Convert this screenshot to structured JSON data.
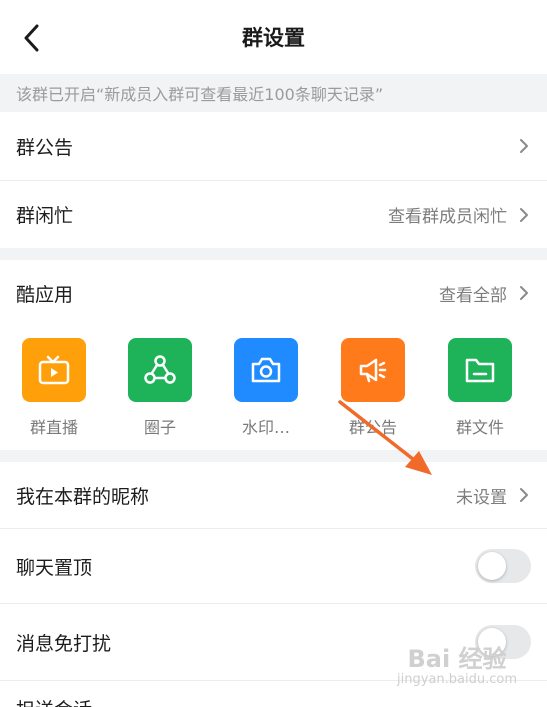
{
  "header": {
    "title": "群设置"
  },
  "notice": "该群已开启“新成员入群可查看最近100条聊天记录”",
  "rows": {
    "announcement": {
      "label": "群公告"
    },
    "busy": {
      "label": "群闲忙",
      "value": "查看群成员闲忙"
    },
    "cool_apps": {
      "label": "酷应用",
      "value": "查看全部"
    },
    "nickname": {
      "label": "我在本群的昵称",
      "value": "未设置"
    },
    "pin_chat": {
      "label": "聊天置顶",
      "enabled": false
    },
    "mute": {
      "label": "消息免打扰",
      "enabled": false
    },
    "partial": {
      "label": "担送会话"
    }
  },
  "apps": [
    {
      "name": "群直播",
      "icon": "tv-icon",
      "color": "#ff9f0a"
    },
    {
      "name": "圈子",
      "icon": "circle-group-icon",
      "color": "#1fb359"
    },
    {
      "name": "水印…",
      "icon": "camera-icon",
      "color": "#1f8bff"
    },
    {
      "name": "群公告",
      "icon": "megaphone-icon",
      "color": "#ff7a1a"
    },
    {
      "name": "群文件",
      "icon": "folder-icon",
      "color": "#1fb359"
    }
  ],
  "colors": {
    "annotation_arrow": "#f06a2a",
    "toggle_off": "#e7e8ea"
  },
  "watermark": {
    "brand": "Bai 经验",
    "url": "jingyan.baidu.com"
  }
}
